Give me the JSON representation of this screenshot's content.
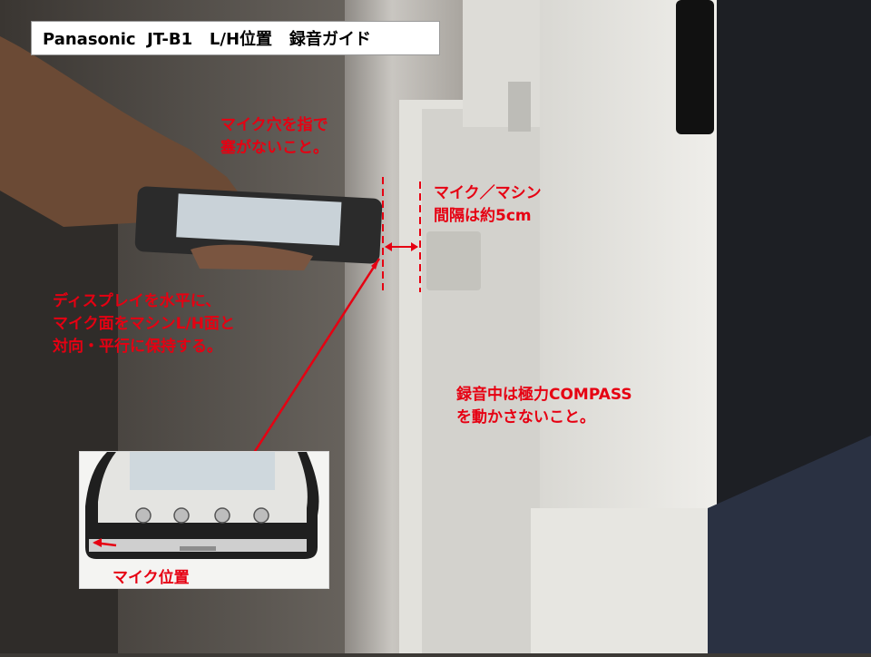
{
  "title": "Panasonic  JT-B1   L/H位置   録音ガイド",
  "annotations": {
    "mic_hole": [
      "マイク穴を指で",
      "塞がないこと。"
    ],
    "spacing": [
      "マイク／マシン",
      "間隔は約5cm"
    ],
    "hold": [
      "ディスプレイを水平に、",
      "マイク面をマシンL/H面と",
      "対向・平行に保持する。"
    ],
    "compass": [
      "録音中は極力COMPASS",
      "を動かさないこと。"
    ]
  },
  "inset": {
    "label": "マイク位置"
  },
  "colors": {
    "annotation": "#e60012",
    "title_bg": "#ffffff",
    "panel": "#ecebe6"
  }
}
